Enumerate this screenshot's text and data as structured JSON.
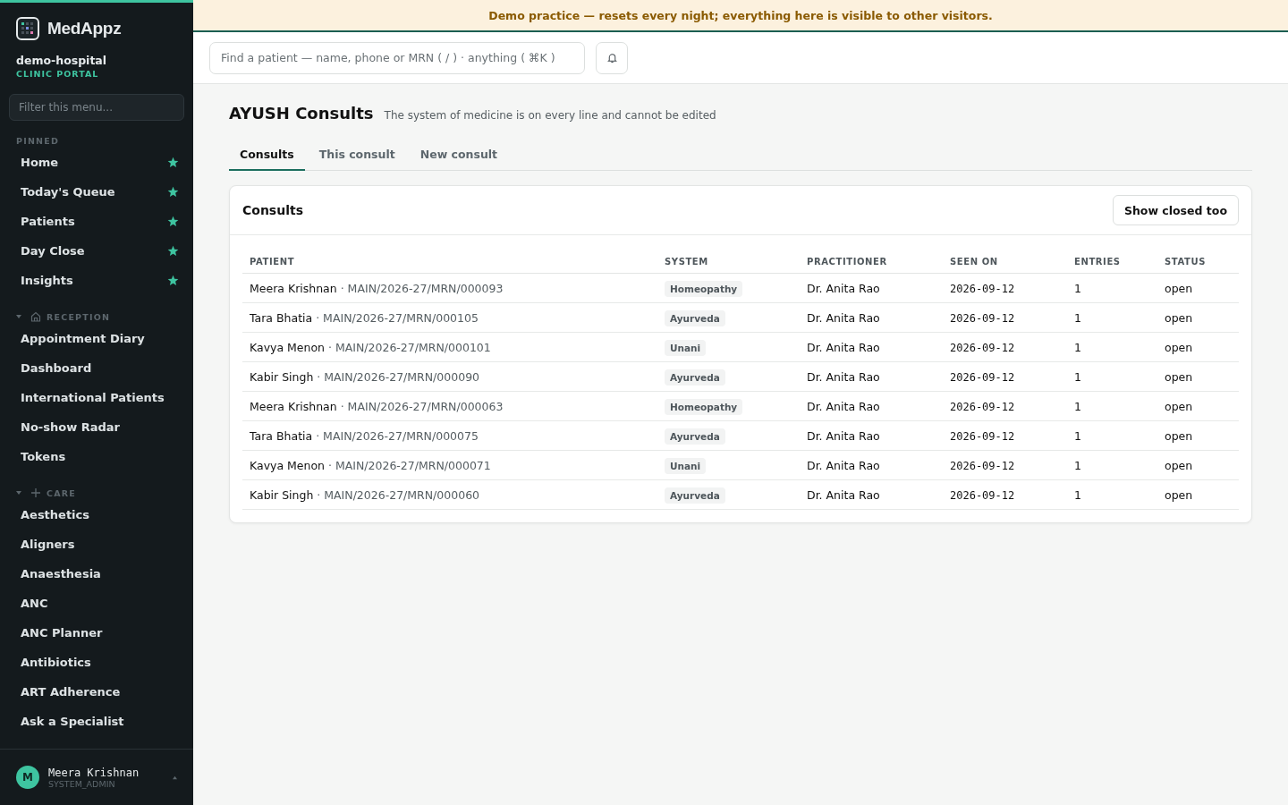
{
  "sidebar": {
    "brand": "MedAppz",
    "org": "demo-hospital",
    "portal": "CLINIC PORTAL",
    "filter": {
      "placeholder": "Filter this menu..."
    },
    "groups": [
      {
        "kind": "pinned",
        "title": "PINNED",
        "items": [
          {
            "label": "Home",
            "pinned": true
          },
          {
            "label": "Today's Queue",
            "pinned": true
          },
          {
            "label": "Patients",
            "pinned": true
          },
          {
            "label": "Day Close",
            "pinned": true
          },
          {
            "label": "Insights",
            "pinned": true
          }
        ]
      },
      {
        "kind": "home",
        "title": "RECEPTION",
        "expanded": true,
        "items": [
          {
            "label": "Appointment Diary",
            "pinned": false
          },
          {
            "label": "Dashboard",
            "pinned": false
          },
          {
            "label": "International Patients",
            "pinned": false
          },
          {
            "label": "No-show Radar",
            "pinned": false
          },
          {
            "label": "Tokens",
            "pinned": false
          }
        ]
      },
      {
        "kind": "plus",
        "title": "CARE",
        "expanded": true,
        "items": [
          {
            "label": "Aesthetics",
            "pinned": false
          },
          {
            "label": "Aligners",
            "pinned": false
          },
          {
            "label": "Anaesthesia",
            "pinned": false
          },
          {
            "label": "ANC",
            "pinned": false
          },
          {
            "label": "ANC Planner",
            "pinned": false
          },
          {
            "label": "Antibiotics",
            "pinned": false
          },
          {
            "label": "ART Adherence",
            "pinned": false
          },
          {
            "label": "Ask a Specialist",
            "pinned": false
          }
        ]
      }
    ],
    "user": {
      "initial": "M",
      "name": "Meera Krishnan",
      "role": "SYSTEM_ADMIN"
    }
  },
  "banner": "Demo practice — resets every night; everything here is visible to other visitors.",
  "search": {
    "placeholder": "Find a patient — name, phone or MRN ( / ) · anything ( ⌘K )"
  },
  "page": {
    "title": "AYUSH Consults",
    "subtitle": "The system of medicine is on every line and cannot be edited"
  },
  "tabs": [
    {
      "label": "Consults",
      "selected": true
    },
    {
      "label": "This consult",
      "selected": false
    },
    {
      "label": "New consult",
      "selected": false
    }
  ],
  "card": {
    "title": "Consults",
    "button": "Show closed too"
  },
  "table": {
    "columns": [
      "PATIENT",
      "SYSTEM",
      "PRACTITIONER",
      "SEEN ON",
      "ENTRIES",
      "STATUS"
    ],
    "rows": [
      {
        "patient": "Meera Krishnan",
        "mrn": "· MAIN/2026-27/MRN/000093",
        "system": "Homeopathy",
        "practitioner": "Dr. Anita Rao",
        "seen_on": "2026-09-12",
        "entries": "1",
        "status": "open"
      },
      {
        "patient": "Tara Bhatia",
        "mrn": "· MAIN/2026-27/MRN/000105",
        "system": "Ayurveda",
        "practitioner": "Dr. Anita Rao",
        "seen_on": "2026-09-12",
        "entries": "1",
        "status": "open"
      },
      {
        "patient": "Kavya Menon",
        "mrn": "· MAIN/2026-27/MRN/000101",
        "system": "Unani",
        "practitioner": "Dr. Anita Rao",
        "seen_on": "2026-09-12",
        "entries": "1",
        "status": "open"
      },
      {
        "patient": "Kabir Singh",
        "mrn": "· MAIN/2026-27/MRN/000090",
        "system": "Ayurveda",
        "practitioner": "Dr. Anita Rao",
        "seen_on": "2026-09-12",
        "entries": "1",
        "status": "open"
      },
      {
        "patient": "Meera Krishnan",
        "mrn": "· MAIN/2026-27/MRN/000063",
        "system": "Homeopathy",
        "practitioner": "Dr. Anita Rao",
        "seen_on": "2026-09-12",
        "entries": "1",
        "status": "open"
      },
      {
        "patient": "Tara Bhatia",
        "mrn": "· MAIN/2026-27/MRN/000075",
        "system": "Ayurveda",
        "practitioner": "Dr. Anita Rao",
        "seen_on": "2026-09-12",
        "entries": "1",
        "status": "open"
      },
      {
        "patient": "Kavya Menon",
        "mrn": "· MAIN/2026-27/MRN/000071",
        "system": "Unani",
        "practitioner": "Dr. Anita Rao",
        "seen_on": "2026-09-12",
        "entries": "1",
        "status": "open"
      },
      {
        "patient": "Kabir Singh",
        "mrn": "· MAIN/2026-27/MRN/000060",
        "system": "Ayurveda",
        "practitioner": "Dr. Anita Rao",
        "seen_on": "2026-09-12",
        "entries": "1",
        "status": "open"
      }
    ]
  }
}
